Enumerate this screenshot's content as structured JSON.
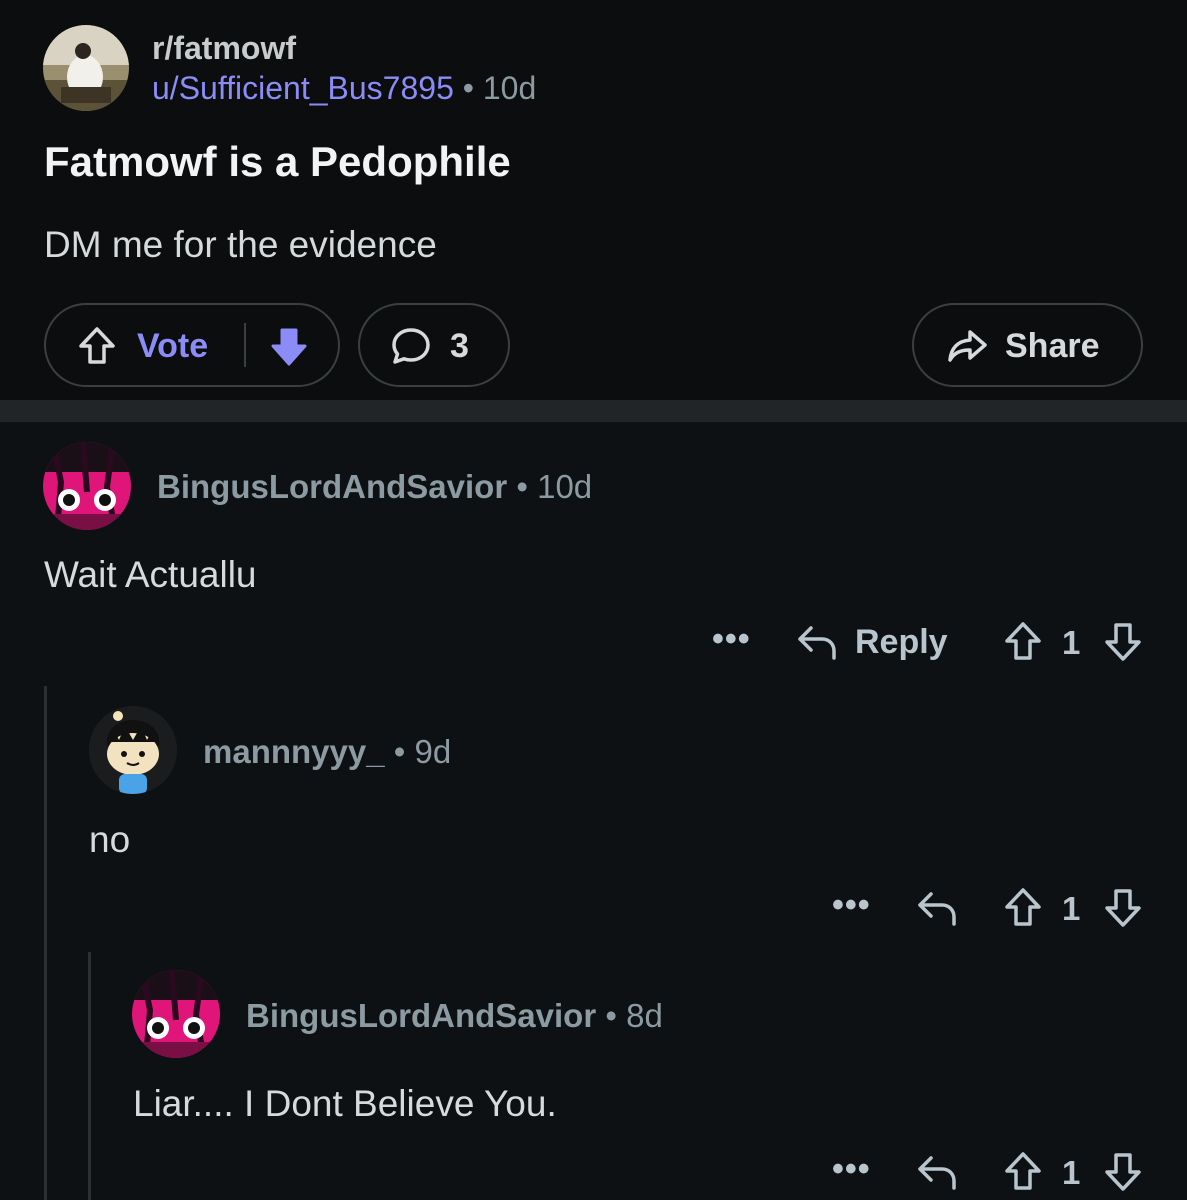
{
  "post": {
    "subreddit": "r/fatmowf",
    "username": "u/Sufficient_Bus7895",
    "separator": "•",
    "age": "10d",
    "title": "Fatmowf is a Pedophile",
    "body": "DM me for the evidence",
    "vote_label": "Vote",
    "comment_count": "3",
    "share_label": "Share",
    "accent": "#8c8cf6",
    "downvote_active_color": "#8c8cf6"
  },
  "comments": [
    {
      "author": "BingusLordAndSavior",
      "separator": "•",
      "age": "10d",
      "text": "Wait Actuallu",
      "more_label": "•••",
      "reply_label": "Reply",
      "score": "1"
    },
    {
      "author": "mannnyyy_",
      "separator": "•",
      "age": "9d",
      "text": "no",
      "more_label": "•••",
      "score": "1"
    },
    {
      "author": "BingusLordAndSavior",
      "separator": "•",
      "age": "8d",
      "text": "Liar.... I Dont Believe You.",
      "more_label": "•••",
      "score": "1"
    }
  ],
  "icons": {
    "upvote": "arrow-up-outline-icon",
    "downvote": "arrow-down-filled-icon",
    "comment": "speech-bubble-icon",
    "share": "share-arrow-icon",
    "reply": "reply-arrow-icon",
    "more": "ellipsis-icon"
  }
}
